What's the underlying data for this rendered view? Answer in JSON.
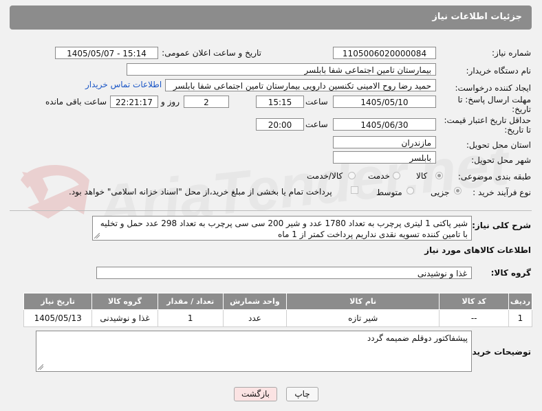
{
  "header": {
    "title": "جزئیات اطلاعات نیاز"
  },
  "form": {
    "need_number_label": "شماره نیاز:",
    "need_number": "1105006020000084",
    "announce_label": "تاریخ و ساعت اعلان عمومی:",
    "announce_value": "1405/05/07 - 15:14",
    "buyer_org_label": "نام دستگاه خریدار:",
    "buyer_org": "بیمارستان تامین اجتماعی شفا بابلسر",
    "creator_label": "ایجاد کننده درخواست:",
    "creator": "حمید رضا روح الامینی تکنسین دارویی بیمارستان تامین اجتماعی شفا بابلسر",
    "contact_link": "اطلاعات تماس خریدار",
    "deadline_label_1": "مهلت ارسال پاسخ: تا",
    "deadline_label_2": "تاریخ:",
    "deadline_date": "1405/05/10",
    "time_label": "ساعت",
    "deadline_time": "15:15",
    "days_value": "2",
    "days_label": "روز و",
    "remaining_time": "22:21:17",
    "remaining_label": "ساعت باقی مانده",
    "validity_label_1": "حداقل تاریخ اعتبار قیمت:",
    "validity_label_2": "تا تاریخ:",
    "validity_date": "1405/06/30",
    "validity_time_label": "ساعت",
    "validity_time": "20:00",
    "province_label": "استان محل تحویل:",
    "province": "مازندران",
    "city_label": "شهر محل تحویل:",
    "city": "بابلسر",
    "category_label": "طبقه بندی موضوعی:",
    "category_options": [
      "کالا",
      "خدمت",
      "کالا/خدمت"
    ],
    "purchase_type_label": "نوع فرآیند خرید :",
    "purchase_options": [
      "جزیی",
      "متوسط"
    ],
    "payment_note": "پرداخت تمام یا بخشی از مبلغ خرید،از محل \"اسناد خزانه اسلامی\" خواهد بود."
  },
  "description": {
    "label": "شرح کلی نیاز:",
    "text": "شیر پاکتی 1 لیتری پرچرب به تعداد 1780 عدد و شیر 200 سی سی پرچرب به تعداد 298 عدد حمل و تخلیه با تامین کننده تسویه نقدی نداریم پرداخت کمتر از 1 ماه"
  },
  "goods": {
    "section_title": "اطلاعات کالاهای مورد نیاز",
    "group_label": "گروه کالا:",
    "group_value": "غذا و نوشیدنی",
    "columns": [
      "ردیف",
      "کد کالا",
      "نام کالا",
      "واحد شمارش",
      "تعداد / مقدار",
      "گروه کالا",
      "تاریخ نیاز"
    ],
    "rows": [
      {
        "row": "1",
        "code": "--",
        "name": "شیر تازه",
        "unit": "عدد",
        "qty": "1",
        "group": "غذا و نوشیدنی",
        "date": "1405/05/13"
      }
    ]
  },
  "buyer_notes": {
    "label": "توضیحات خریدار:",
    "text": "پیشفاکتور دوقلم ضمیمه گردد"
  },
  "buttons": {
    "print": "چاپ",
    "back": "بازگشت"
  },
  "colors": {
    "header_bg": "#8c8c8c",
    "link": "#1a56c6",
    "back_button_bg": "#fbe3e3"
  }
}
